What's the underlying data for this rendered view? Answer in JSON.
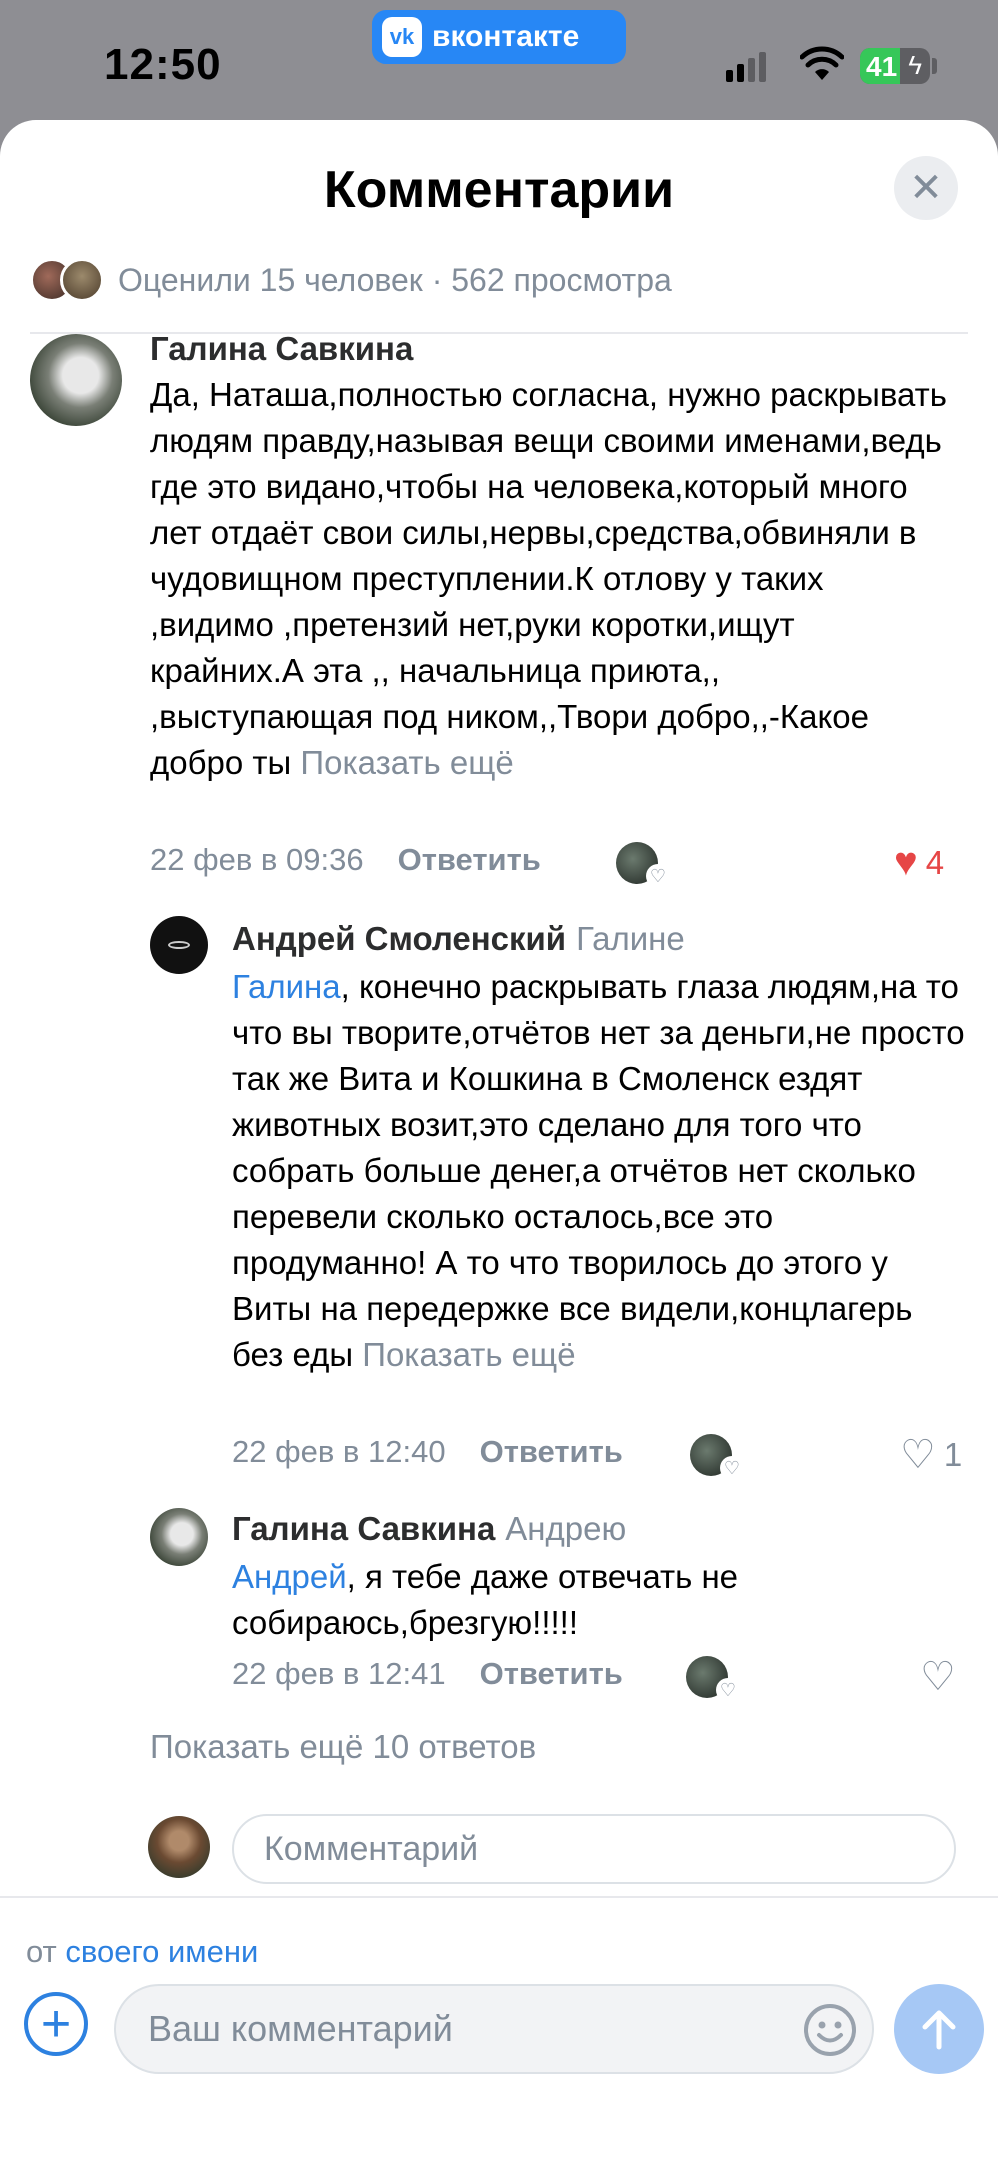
{
  "status_bar": {
    "time": "12:50",
    "app_badge": "вконтакте",
    "vk_logo_text": "vk",
    "battery": "41"
  },
  "sheet": {
    "title": "Комментарии",
    "stats": "Оценили 15 человек · 562 просмотра"
  },
  "comments": [
    {
      "author": "Галина Савкина",
      "text": "Да, Наташа,полностью согласна, нужно раскрывать людям правду,называя вещи своими именами,ведь где это видано,чтобы на человека,который много лет отдаёт свои силы,нервы,средства,обвиняли в чудовищном преступлении.К отлову у таких ,видимо ,претензий нет,руки коротки,ищут крайних.А эта ,, начальница приюта,,  ,выступающая под ником,,Твори добро,,-Какое добро  ты",
      "more": "Показать ещё",
      "date": "22 фев в 09:36",
      "reply_label": "Ответить",
      "likes": "4"
    },
    {
      "author": "Андрей Смоленский",
      "to": "Галине",
      "mention": "Галина",
      "text": ", конечно раскрывать глаза людям,на то что вы творите,отчётов нет за деньги,не просто так же Вита и Кошкина в Смоленск ездят животных возит,это сделано для того что собрать больше денег,а отчётов нет сколько перевели сколько осталось,все это продуманно! А то что творилось до этого у Виты на передержке все видели,концлагерь без еды",
      "more": "Показать ещё",
      "date": "22 фев в 12:40",
      "reply_label": "Ответить",
      "likes": "1"
    },
    {
      "author": "Галина Савкина",
      "to": "Андрею",
      "mention": "Андрей",
      "text": ", я тебе даже отвечать не собираюсь,брезгую!!!!!",
      "date": "22 фев в 12:41",
      "reply_label": "Ответить"
    }
  ],
  "show_more_replies": "Показать ещё 10 ответов",
  "reply_input_placeholder": "Комментарий",
  "bottom": {
    "from_prefix": "от",
    "from_link": "своего имени",
    "input_placeholder": "Ваш комментарий"
  },
  "colors": {
    "accent": "#2d81e0",
    "like_red": "#e64646",
    "secondary_text": "#818c99"
  },
  "icons": [
    "close-icon",
    "heart-icon",
    "heart-outline-icon",
    "plus-icon",
    "smile-icon",
    "send-arrow-icon",
    "wifi-icon",
    "battery-icon"
  ]
}
